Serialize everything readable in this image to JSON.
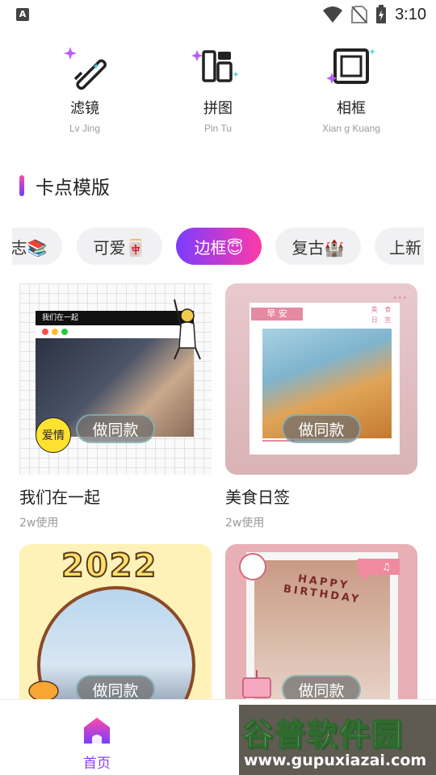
{
  "status_bar": {
    "time": "3:10",
    "left_badge": "A"
  },
  "tools": [
    {
      "label": "滤镜",
      "sub": "Lv Jing",
      "icon": "magic-wand-icon"
    },
    {
      "label": "拼图",
      "sub": "Pin Tu",
      "icon": "collage-grid-icon"
    },
    {
      "label": "相框",
      "sub": "Xian  g Kuang",
      "icon": "photo-frame-icon"
    }
  ],
  "section": {
    "title": "卡点模版"
  },
  "chips": [
    {
      "label": "志📚"
    },
    {
      "label": "可爱🀄"
    },
    {
      "label": "边框😇",
      "active": true
    },
    {
      "label": "复古🏰"
    },
    {
      "label": "上新"
    }
  ],
  "templates": [
    {
      "title": "我们在一起",
      "usage": "2w使用",
      "button": "做同款",
      "inner_title": "我们在一起",
      "badge": "爱情"
    },
    {
      "title": "美食日签",
      "usage": "2w使用",
      "button": "做同款",
      "inner_title": "早 安",
      "stamp": "美 食 日 签"
    },
    {
      "title": "",
      "usage": "",
      "button": "做同款",
      "year": "2022"
    },
    {
      "title": "",
      "usage": "",
      "button": "做同款",
      "banner": "HAPPY BIRTHDAY"
    }
  ],
  "nav": {
    "home_label": "首页"
  },
  "watermark": {
    "main": "谷普软件园",
    "url": "www.gupuxiazai.com"
  },
  "colors": {
    "accent_purple": "#8a3cff",
    "accent_pink": "#ff3aa8"
  }
}
